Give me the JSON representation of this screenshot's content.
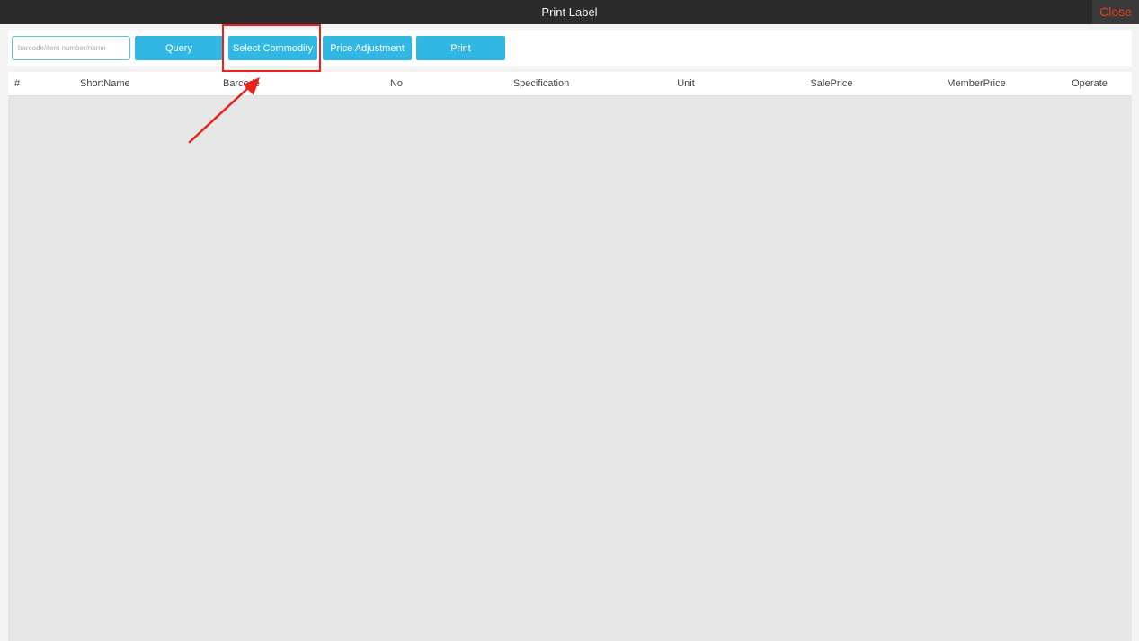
{
  "window": {
    "title": "Print Label",
    "close_label": "Close"
  },
  "toolbar": {
    "search_placeholder": "barcode/item number/name",
    "search_value": "",
    "query_label": "Query",
    "select_commodity_label": "Select Commodity",
    "price_adjustment_label": "Price Adjustment",
    "print_label": "Print"
  },
  "table": {
    "columns": [
      "#",
      "ShortName",
      "Barcode",
      "No",
      "Specification",
      "Unit",
      "SalePrice",
      "MemberPrice",
      "Operate"
    ],
    "rows": []
  },
  "colors": {
    "accent": "#30b7e3",
    "titlebar": "#2b2b2b",
    "close_text": "#e2401c",
    "annotation": "#e8231b",
    "table_body": "#e6e6e6"
  }
}
